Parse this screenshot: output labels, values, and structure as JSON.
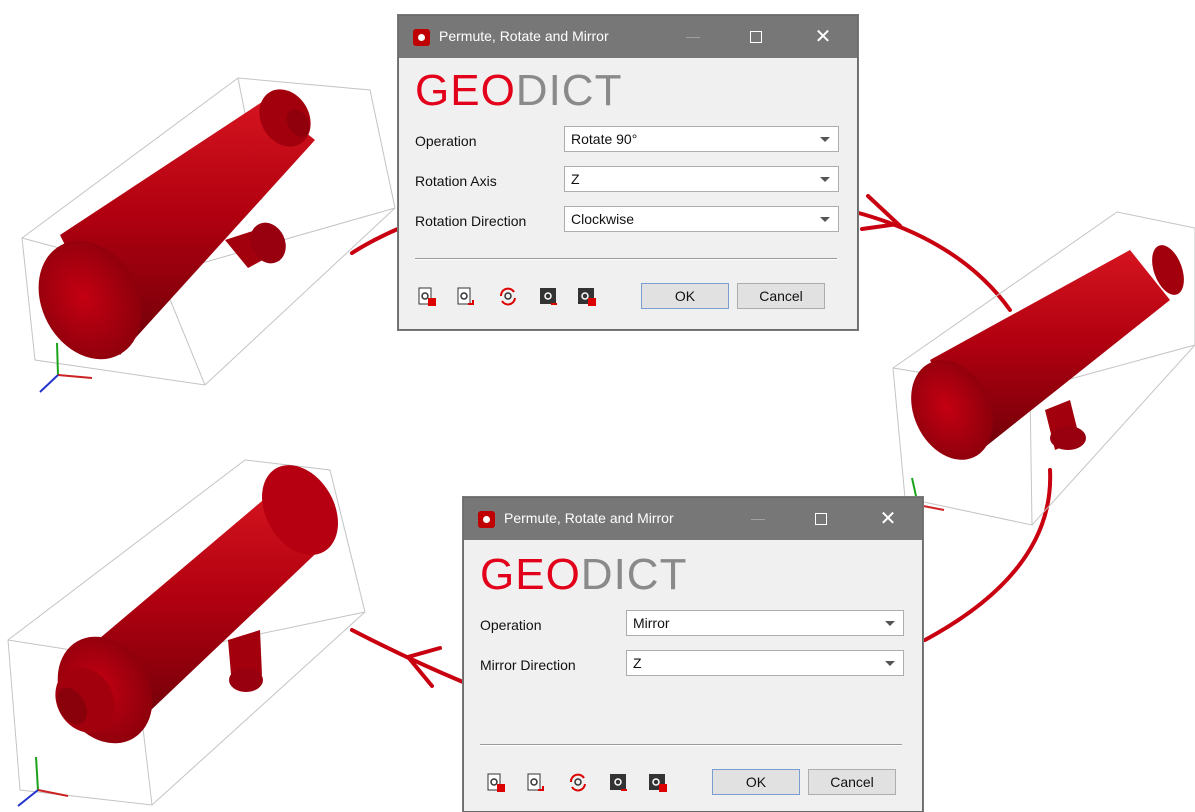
{
  "dialog_top": {
    "title": "Permute, Rotate and Mirror",
    "logo_geo": "GEO",
    "logo_dict": "DICT",
    "rows": [
      {
        "label": "Operation",
        "value": "Rotate 90°"
      },
      {
        "label": "Rotation Axis",
        "value": "Z"
      },
      {
        "label": "Rotation Direction",
        "value": "Clockwise"
      }
    ],
    "ok_label": "OK",
    "cancel_label": "Cancel"
  },
  "dialog_bottom": {
    "title": "Permute, Rotate and Mirror",
    "logo_geo": "GEO",
    "logo_dict": "DICT",
    "rows": [
      {
        "label": "Operation",
        "value": "Mirror"
      },
      {
        "label": "Mirror Direction",
        "value": "Z"
      }
    ],
    "ok_label": "OK",
    "cancel_label": "Cancel"
  },
  "colors": {
    "brand_red": "#e2001a",
    "model_red": "#b3000f",
    "arrow_red": "#c8000f",
    "titlebar_gray": "#777777"
  },
  "toolbar_icons": [
    "load-settings-icon",
    "save-settings-icon",
    "reset-settings-icon",
    "record-macro-icon",
    "settings-lock-icon"
  ]
}
